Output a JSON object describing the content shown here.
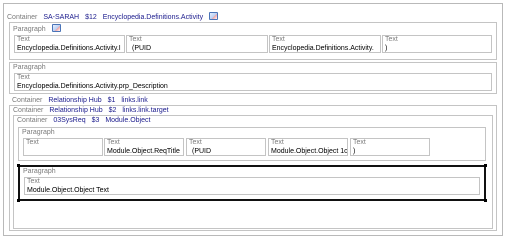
{
  "outer": {
    "label": "Container",
    "id": "SA-SARAH",
    "var": "$12",
    "binding": "Encyclopedia.Definitions.Activity"
  },
  "para1": {
    "label": "Paragraph",
    "cells": [
      {
        "label": "Text",
        "value": "Encyclopedia.Definitions.Activity.I"
      },
      {
        "label": "Text",
        "value": "(PUID"
      },
      {
        "label": "Text",
        "value": "Encyclopedia.Definitions.Activity."
      },
      {
        "label": "Text",
        "value": ")"
      }
    ]
  },
  "para2": {
    "label": "Paragraph",
    "cells": [
      {
        "label": "Text",
        "value": "Encyclopedia.Definitions.Activity.prp_Description"
      }
    ]
  },
  "hub": {
    "label": "Container",
    "id": "Relationship Hub",
    "var": "$1",
    "binding": "links.link"
  },
  "hub2": {
    "label": "Container",
    "id": "Relationship Hub",
    "var": "$2",
    "binding": "links.link.target"
  },
  "sysreq": {
    "label": "Container",
    "id": "03SysReq",
    "var": "$3",
    "binding": "Module.Object"
  },
  "para3": {
    "label": "Paragraph",
    "cells": [
      {
        "label": "Text",
        "value": ""
      },
      {
        "label": "Text",
        "value": "Module.Object.ReqTitle"
      },
      {
        "label": "Text",
        "value": "(PUID"
      },
      {
        "label": "Text",
        "value": "Module.Object.Object 1c"
      },
      {
        "label": "Text",
        "value": ")"
      }
    ]
  },
  "para4": {
    "label": "Paragraph",
    "cells": [
      {
        "label": "Text",
        "value": "Module.Object.Object Text"
      }
    ]
  },
  "colors": {
    "border": "#c4c4c4",
    "label": "#7b7b7b",
    "binding": "#1a1a8c",
    "selection": "#111111"
  },
  "icons": [
    "module-icon",
    "paragraph-icon"
  ]
}
